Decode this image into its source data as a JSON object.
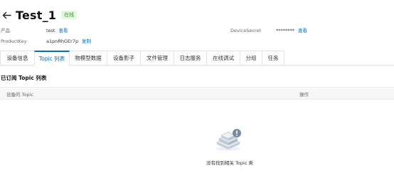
{
  "device": {
    "name": "Test_1",
    "status": "在线"
  },
  "info": {
    "product_label": "产品",
    "product_value": "test",
    "product_link": "查看",
    "productkey_label": "ProductKey",
    "productkey_value": "a1pnRhGEr7p",
    "productkey_link": "复制",
    "devicesecret_label": "DeviceSecret",
    "devicesecret_value": "********",
    "devicesecret_link": "查看"
  },
  "tabs": [
    {
      "label": "设备信息"
    },
    {
      "label": "Topic 列表"
    },
    {
      "label": "物模型数据"
    },
    {
      "label": "设备影子"
    },
    {
      "label": "文件管理"
    },
    {
      "label": "日志服务"
    },
    {
      "label": "在线调试"
    },
    {
      "label": "分组"
    },
    {
      "label": "任务"
    }
  ],
  "active_tab": "Topic 列表",
  "section": {
    "title": "已订阅 Topic 列表",
    "columns": [
      "设备的 Topic",
      "操作"
    ],
    "empty_text": "没有找到相关 Topic 类"
  },
  "colors": {
    "accent": "#0070cc",
    "status_bg": "#e6f7e1",
    "status_fg": "#3a9a2a"
  },
  "icons": {
    "back": "arrow-left-icon",
    "empty": "empty-box-icon"
  }
}
